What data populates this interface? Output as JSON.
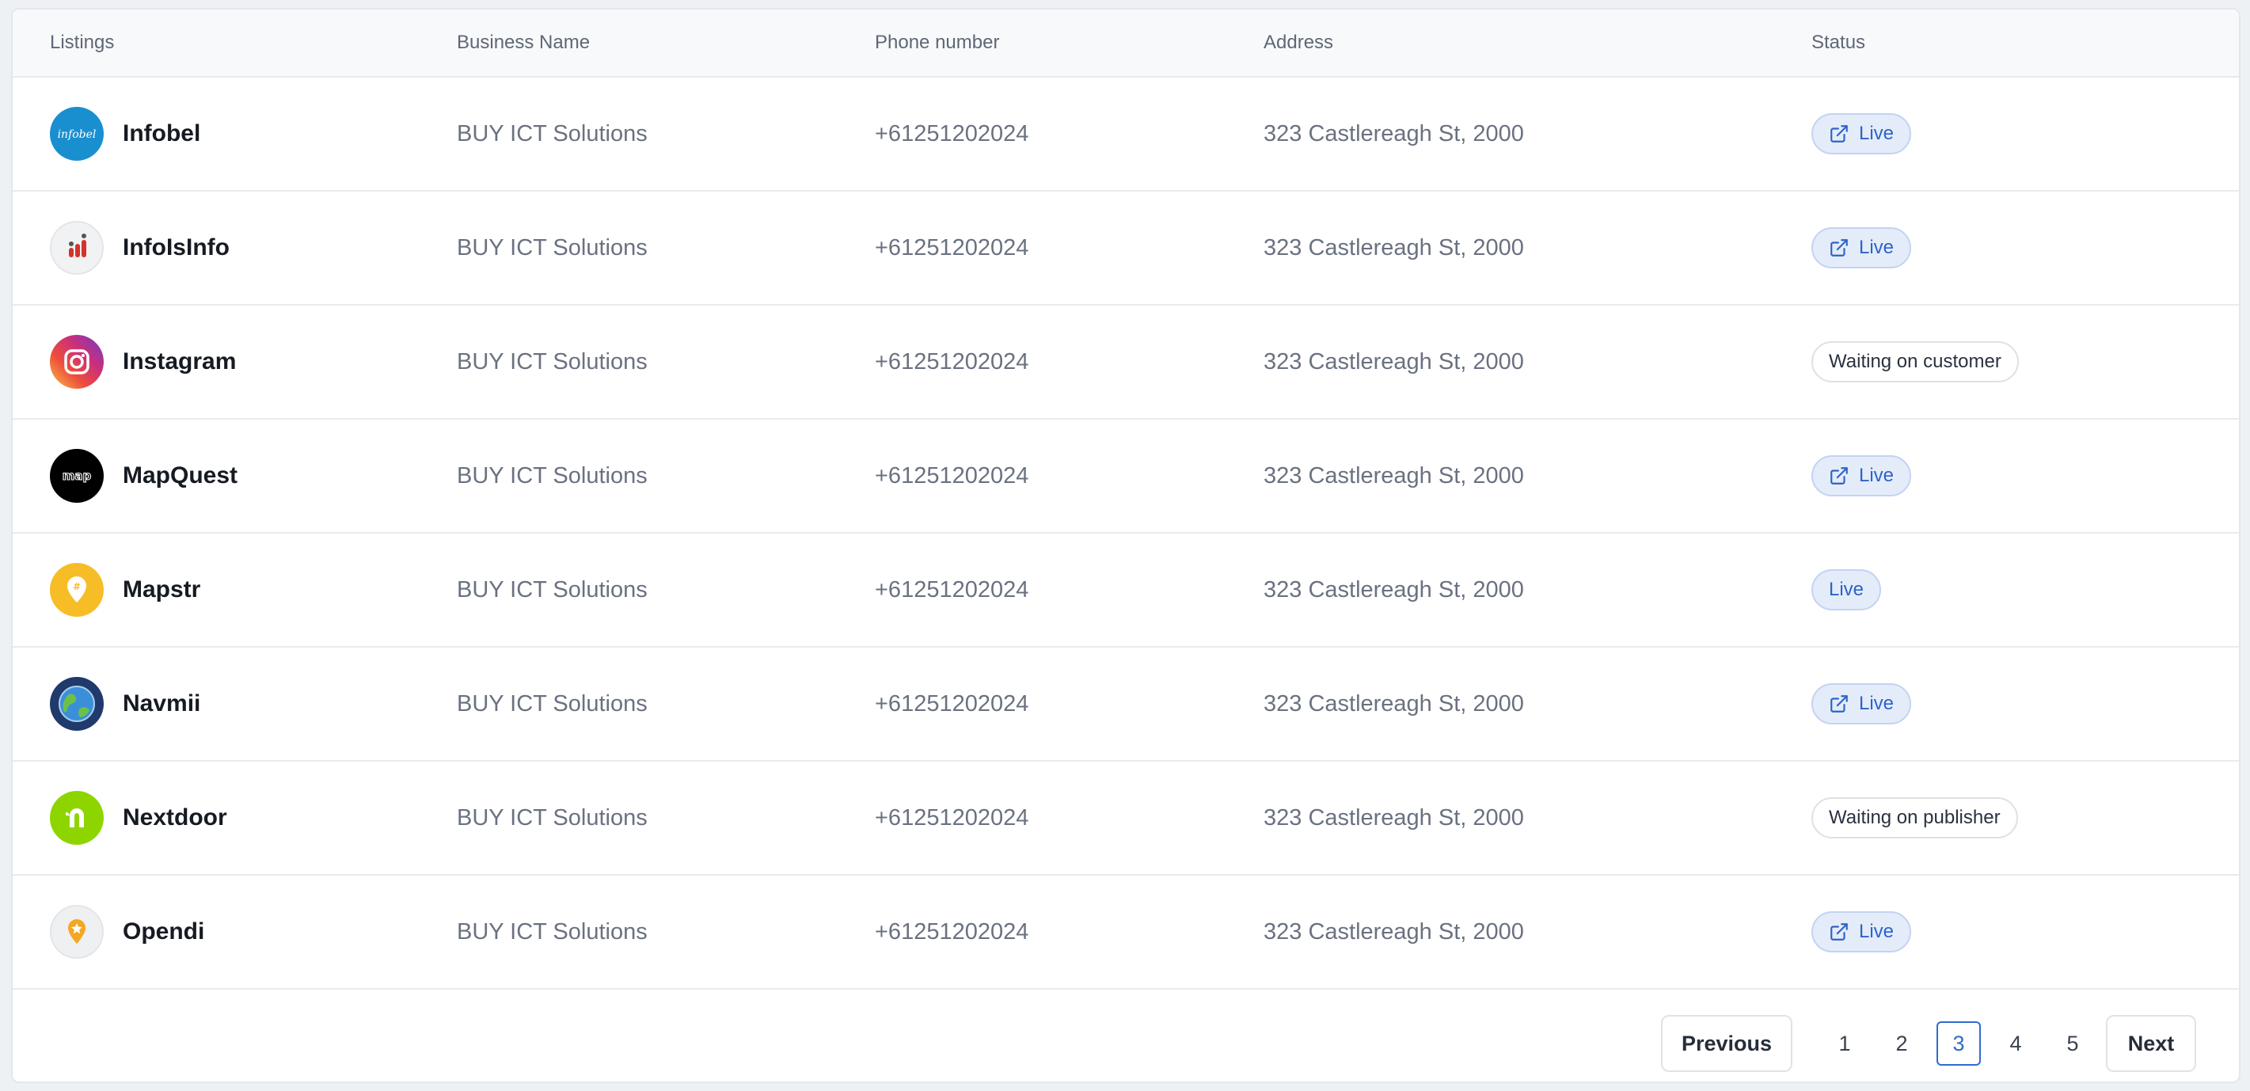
{
  "columns": {
    "listings": "Listings",
    "business_name": "Business Name",
    "phone": "Phone number",
    "address": "Address",
    "status": "Status"
  },
  "rows": [
    {
      "name": "Infobel",
      "icon": "infobel-logo-icon",
      "business": "BUY ICT Solutions",
      "phone": "+61251202024",
      "address": "323 Castlereagh St, 2000",
      "status": "Live",
      "status_type": "live",
      "external_link": true
    },
    {
      "name": "InfoIsInfo",
      "icon": "infoisinfo-logo-icon",
      "business": "BUY ICT Solutions",
      "phone": "+61251202024",
      "address": "323 Castlereagh St, 2000",
      "status": "Live",
      "status_type": "live",
      "external_link": true
    },
    {
      "name": "Instagram",
      "icon": "instagram-logo-icon",
      "business": "BUY ICT Solutions",
      "phone": "+61251202024",
      "address": "323 Castlereagh St, 2000",
      "status": "Waiting on customer",
      "status_type": "waiting",
      "external_link": false
    },
    {
      "name": "MapQuest",
      "icon": "mapquest-logo-icon",
      "business": "BUY ICT Solutions",
      "phone": "+61251202024",
      "address": "323 Castlereagh St, 2000",
      "status": "Live",
      "status_type": "live",
      "external_link": true
    },
    {
      "name": "Mapstr",
      "icon": "mapstr-logo-icon",
      "business": "BUY ICT Solutions",
      "phone": "+61251202024",
      "address": "323 Castlereagh St, 2000",
      "status": "Live",
      "status_type": "live",
      "external_link": false
    },
    {
      "name": "Navmii",
      "icon": "navmii-logo-icon",
      "business": "BUY ICT Solutions",
      "phone": "+61251202024",
      "address": "323 Castlereagh St, 2000",
      "status": "Live",
      "status_type": "live",
      "external_link": true
    },
    {
      "name": "Nextdoor",
      "icon": "nextdoor-logo-icon",
      "business": "BUY ICT Solutions",
      "phone": "+61251202024",
      "address": "323 Castlereagh St, 2000",
      "status": "Waiting on publisher",
      "status_type": "waiting",
      "external_link": false
    },
    {
      "name": "Opendi",
      "icon": "opendi-logo-icon",
      "business": "BUY ICT Solutions",
      "phone": "+61251202024",
      "address": "323 Castlereagh St, 2000",
      "status": "Live",
      "status_type": "live",
      "external_link": true
    }
  ],
  "pagination": {
    "previous_label": "Previous",
    "next_label": "Next",
    "pages": [
      "1",
      "2",
      "3",
      "4",
      "5"
    ],
    "current_page": "3"
  },
  "logo_texts": {
    "infobel": "infobel",
    "mapquest": "map",
    "mapstr": "#"
  },
  "colors": {
    "live_text": "#2d63c8",
    "live_bg": "#e4ecfa",
    "active_page": "#2f6bd0",
    "infobel": "#1a8fd0",
    "nextdoor": "#8ed500",
    "mapstr": "#f7bd27",
    "navmii": "#1f3a6b"
  }
}
